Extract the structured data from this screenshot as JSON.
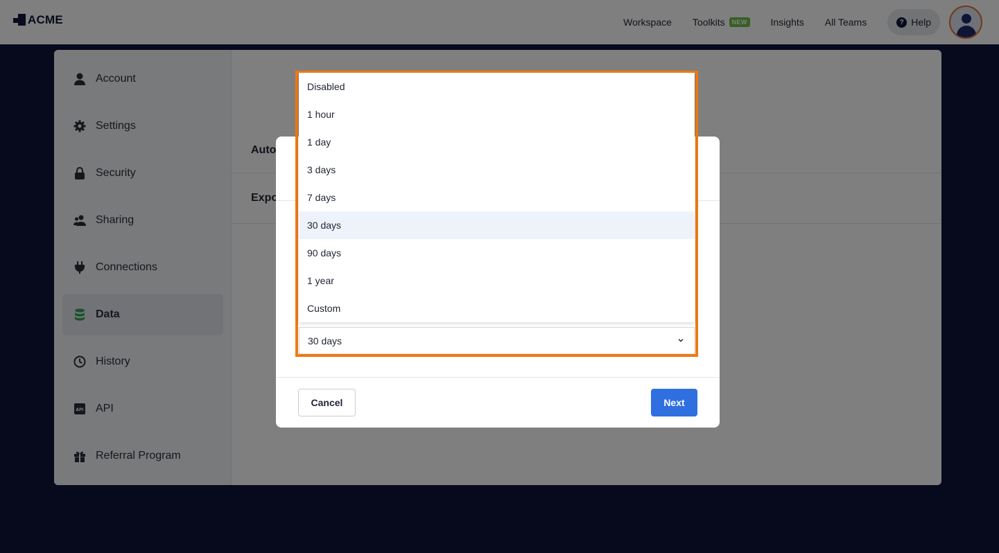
{
  "app": {
    "logo_text": "ACME"
  },
  "nav": {
    "workspace": "Workspace",
    "toolkits": "Toolkits",
    "toolkits_badge": "NEW",
    "insights": "Insights",
    "all_teams": "All Teams",
    "help": "Help",
    "help_icon_glyph": "?"
  },
  "sidebar": {
    "items": [
      {
        "label": "Account",
        "icon": "user-icon"
      },
      {
        "label": "Settings",
        "icon": "gear-icon"
      },
      {
        "label": "Security",
        "icon": "lock-icon"
      },
      {
        "label": "Sharing",
        "icon": "users-icon"
      },
      {
        "label": "Connections",
        "icon": "plug-icon"
      },
      {
        "label": "Data",
        "icon": "database-icon",
        "active": true
      },
      {
        "label": "History",
        "icon": "history-icon"
      },
      {
        "label": "API",
        "icon": "api-icon"
      },
      {
        "label": "Referral Program",
        "icon": "gift-icon"
      }
    ]
  },
  "content": {
    "row1_label": "Auto",
    "row2_label": "Expo"
  },
  "dropdown": {
    "options": [
      "Disabled",
      "1 hour",
      "1 day",
      "3 days",
      "7 days",
      "30 days",
      "90 days",
      "1 year",
      "Custom"
    ],
    "hovered_option": "30 days",
    "selected_value": "30 days"
  },
  "modal": {
    "cancel_label": "Cancel",
    "next_label": "Next"
  },
  "colors": {
    "accent_blue": "#2f6fe0",
    "highlight_orange": "#f07a12",
    "badge_green": "#6fbf4a",
    "navy": "#10153a"
  }
}
